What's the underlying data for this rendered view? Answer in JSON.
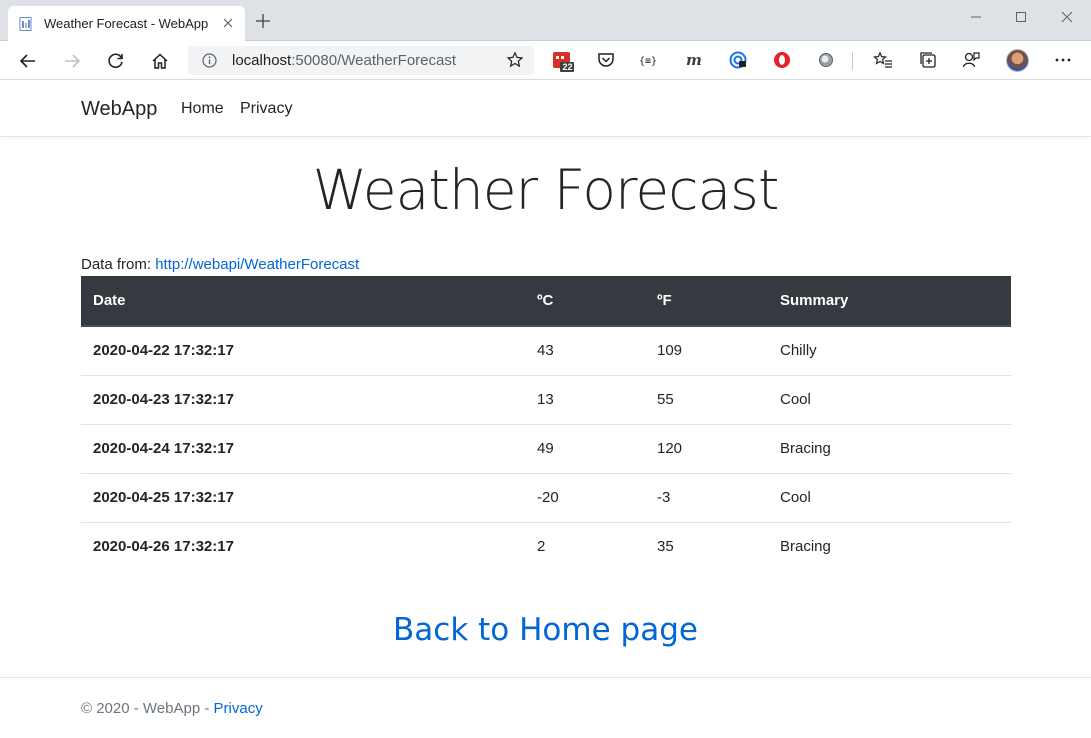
{
  "browser": {
    "tab_title": "Weather Forecast - WebApp",
    "url_host": "localhost",
    "url_rest": ":50080/WeatherForecast",
    "calendar_badge": "22"
  },
  "nav": {
    "brand": "WebApp",
    "links": [
      "Home",
      "Privacy"
    ]
  },
  "main": {
    "title": "Weather Forecast",
    "data_from_label": "Data from: ",
    "data_from_url": "http://webapi/WeatherForecast",
    "table": {
      "headers": [
        "Date",
        "ºC",
        "ºF",
        "Summary"
      ],
      "rows": [
        [
          "2020-04-22 17:32:17",
          "43",
          "109",
          "Chilly"
        ],
        [
          "2020-04-23 17:32:17",
          "13",
          "55",
          "Cool"
        ],
        [
          "2020-04-24 17:32:17",
          "49",
          "120",
          "Bracing"
        ],
        [
          "2020-04-25 17:32:17",
          "-20",
          "-3",
          "Cool"
        ],
        [
          "2020-04-26 17:32:17",
          "2",
          "35",
          "Bracing"
        ]
      ]
    },
    "back_link": "Back to Home page"
  },
  "footer": {
    "text": "© 2020 - WebApp - ",
    "privacy": "Privacy"
  },
  "colors": {
    "link": "#0366d6",
    "table_header_bg": "#343a40",
    "tab_strip_bg": "#dee1e6"
  }
}
